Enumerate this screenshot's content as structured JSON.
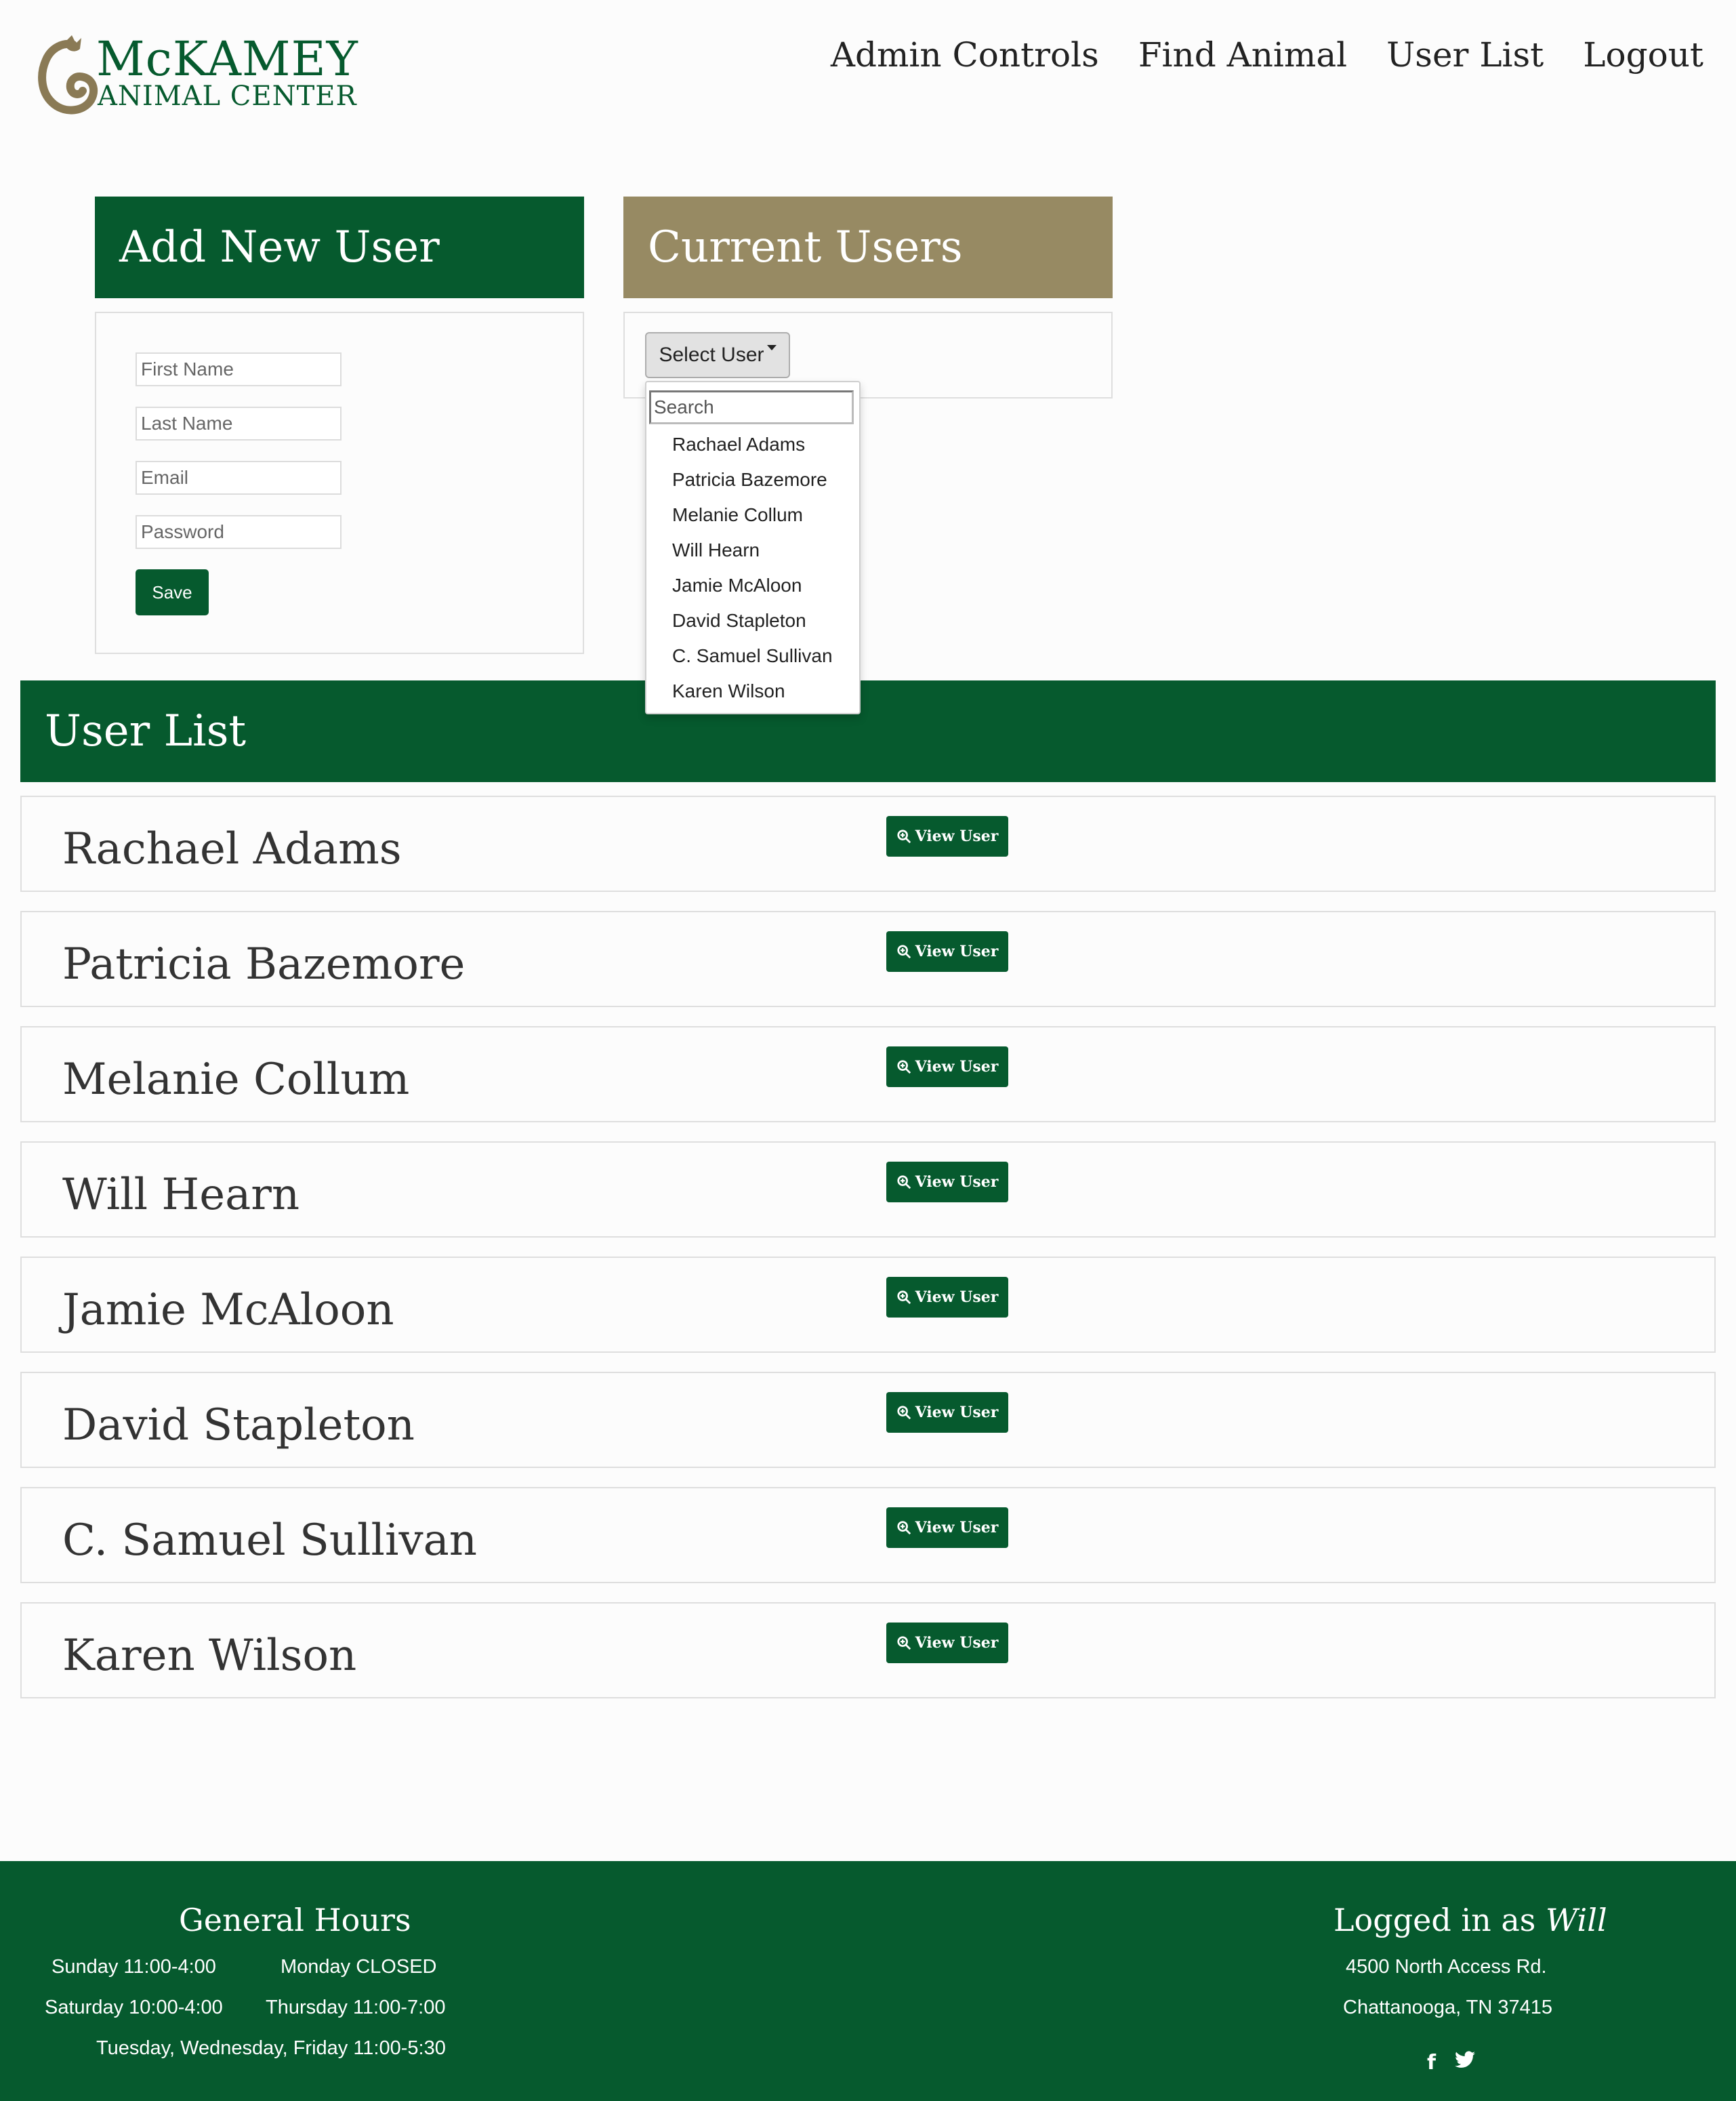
{
  "header": {
    "logo_line1": "McKAMEY",
    "logo_line2": "ANIMAL CENTER",
    "nav": [
      "Admin Controls",
      "Find Animal",
      "User List",
      "Logout"
    ]
  },
  "add_user": {
    "title": "Add New User",
    "first_name_placeholder": "First Name",
    "last_name_placeholder": "Last Name",
    "email_placeholder": "Email",
    "password_placeholder": "Password",
    "save_label": "Save"
  },
  "current_users": {
    "title": "Current Users",
    "select_label": "Select User",
    "search_placeholder": "Search",
    "options": [
      "Rachael Adams",
      "Patricia Bazemore",
      "Melanie Collum",
      "Will Hearn",
      "Jamie McAloon",
      "David Stapleton",
      "C. Samuel Sullivan",
      "Karen Wilson"
    ]
  },
  "user_list": {
    "title": "User List",
    "view_label": "View User",
    "users": [
      "Rachael Adams",
      "Patricia Bazemore",
      "Melanie Collum",
      "Will Hearn",
      "Jamie McAloon",
      "David Stapleton",
      "C. Samuel Sullivan",
      "Karen Wilson"
    ]
  },
  "footer": {
    "hours_title": "General Hours",
    "hours": [
      "Sunday 11:00-4:00",
      "Monday CLOSED",
      "Saturday 10:00-4:00",
      "Thursday 11:00-7:00",
      "Tuesday, Wednesday, Friday 11:00-5:30"
    ],
    "logged_in_prefix": "Logged in as",
    "logged_in_user": "Will",
    "address_line1": "4500 North Access Rd.",
    "address_line2": "Chattanooga, TN 37415",
    "social_icons": [
      "facebook-icon",
      "twitter-icon"
    ]
  },
  "colors": {
    "brand_green": "#065a2e",
    "tan": "#978a63",
    "logo_mark": "#8a7a55"
  }
}
